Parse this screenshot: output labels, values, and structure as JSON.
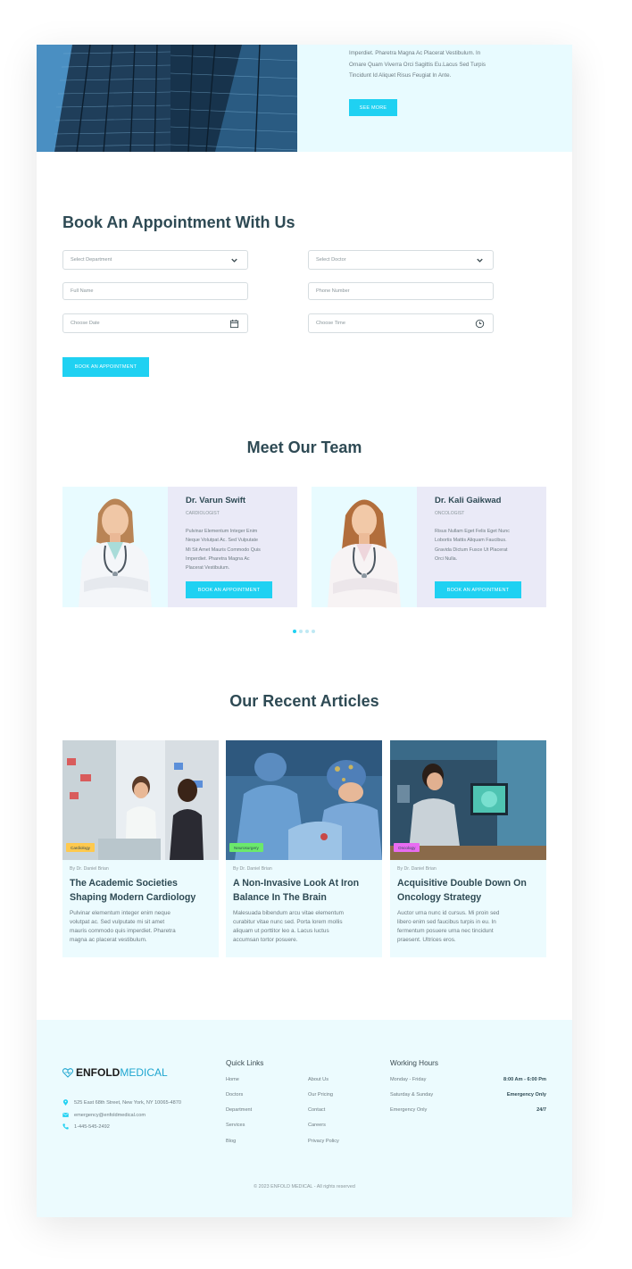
{
  "hero": {
    "text_lines": [
      "Imperdiet. Pharetra Magna Ac Placerat Vestibulum. In",
      "Ornare Quam Viverra Orci Sagittis Eu.Lacus Sed Turpis",
      "Tincidunt Id Aliquet Risus Feugiat In Ante."
    ],
    "button_label": "SEE MORE"
  },
  "appointment": {
    "title": "Book An Appointment With Us",
    "department_placeholder": "Select Department",
    "doctor_placeholder": "Select Doctor",
    "name_placeholder": "Full Name",
    "phone_placeholder": "Phone Number",
    "date_placeholder": "Choose Date",
    "time_placeholder": "Choose Time",
    "submit_label": "BOOK AN APPOINTMENT"
  },
  "team": {
    "title": "Meet Our Team",
    "members": [
      {
        "name": "Dr. Varun Swift",
        "role": "CARDIOLOGIST",
        "desc_lines": [
          "Pulvinar Elementum Integer Enim",
          "Neque Volutpat Ac. Sed Vulputate",
          "Mi Sit Amet Mauris Commodo Quis",
          "Imperdiet. Pharetra Magna Ac",
          "Placerat Vestibulum."
        ],
        "button_label": "BOOK AN APPOINTMENT"
      },
      {
        "name": "Dr. Kali Gaikwad",
        "role": "ONCOLOGIST",
        "desc_lines": [
          "Risus Nullam Eget Felis Eget Nunc",
          "Lobortis Mattis Aliquam Faucibus.",
          "Gravida Dictum Fusce Ut Placerat",
          "Orci Nulla."
        ],
        "button_label": "BOOK AN APPOINTMENT"
      }
    ]
  },
  "articles": {
    "title": "Our Recent Articles",
    "items": [
      {
        "tag": "Cardiology",
        "tag_color": "#ffc94d",
        "author": "By Dr. Daniel Brian",
        "title_lines": [
          "The Academic Societies",
          "Shaping Modern Cardiology"
        ],
        "excerpt_lines": [
          "Pulvinar elementum integer enim neque",
          "volutpat ac. Sed vulputate mi sit amet",
          "mauris commodo quis imperdiet. Pharetra",
          "magna ac placerat vestibulum."
        ]
      },
      {
        "tag": "Neurosurgery",
        "tag_color": "#6be96b",
        "author": "By Dr. Daniel Brian",
        "title_lines": [
          "A Non-Invasive Look At Iron",
          "Balance In The Brain"
        ],
        "excerpt_lines": [
          "Malesuada bibendum arcu vitae elementum",
          "curabitur vitae nunc sed. Porta lorem mollis",
          "aliquam ut porttitor leo a. Lacus luctus",
          "accumsan tortor posuere."
        ]
      },
      {
        "tag": "Oncology",
        "tag_color": "#e86cf2",
        "author": "By Dr. Daniel Brian",
        "title_lines": [
          "Acquisitive Double Down On",
          "Oncology Strategy"
        ],
        "excerpt_lines": [
          "Auctor urna nunc id cursus. Mi proin sed",
          "libero enim sed faucibus turpis in eu. In",
          "fermentum posuere urna nec tincidunt",
          "praesent. Ultrices eros."
        ]
      }
    ]
  },
  "footer": {
    "logo_bold": "ENFOLD",
    "logo_light": "MEDICAL",
    "address": "525 East 68th Street, New York, NY 10065-4870",
    "email": "emergency@enfoldmedical.com",
    "phone": "1-445-545-2492",
    "quick_links_title": "Quick Links",
    "quick_links_col1": [
      "Home",
      "Doctors",
      "Department",
      "Services",
      "Blog"
    ],
    "quick_links_col2": [
      "About Us",
      "Our Pricing",
      "Contact",
      "Careers",
      "Privacy Policy"
    ],
    "hours_title": "Working Hours",
    "hours": [
      {
        "day": "Monday - Friday",
        "time": "8:00 Am - 6:00 Pm"
      },
      {
        "day": "Saturday & Sunday",
        "time": "Emergency Only"
      },
      {
        "day": "Emergency Only",
        "time": "24/7"
      }
    ],
    "copyright": "© 2023 ENFOLD MEDICAL -  All rights reserved"
  },
  "colors": {
    "accent": "#1fd1f2",
    "heading": "#2e4a54",
    "light_bg": "#e8fbff",
    "card_bg": "#eaeaf7"
  }
}
